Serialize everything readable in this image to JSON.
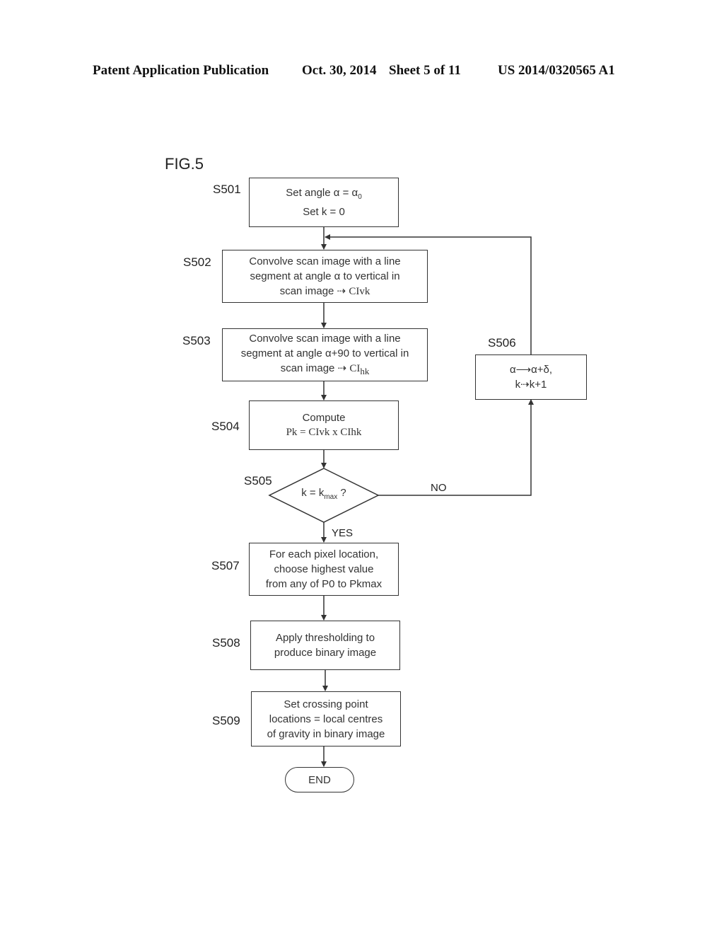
{
  "header": {
    "publication": "Patent Application Publication",
    "date": "Oct. 30, 2014",
    "sheet": "Sheet 5 of 11",
    "number": "US 2014/0320565 A1"
  },
  "figure": {
    "title": "FIG.5"
  },
  "steps": {
    "s501": {
      "label": "S501",
      "line1": "Set angle α = α",
      "line1_sub": "0",
      "line2": "Set k = 0"
    },
    "s502": {
      "label": "S502",
      "line1": "Convolve scan image with a line",
      "line2": "segment at angle α to vertical in",
      "line3": "scan image ⇢ ",
      "line3_var": "CIvk"
    },
    "s503": {
      "label": "S503",
      "line1": "Convolve scan image with a line",
      "line2": "segment at angle α+90 to vertical in",
      "line3": "scan image ⇢ ",
      "line3_var": "CI",
      "line3_sub": "hk"
    },
    "s504": {
      "label": "S504",
      "line1": "Compute",
      "line2": "Pk = CIvk x CIhk"
    },
    "s505": {
      "label": "S505",
      "text": "k = k",
      "text_sub": "max",
      "text_end": " ?",
      "no_label": "NO",
      "yes_label": "YES"
    },
    "s506": {
      "label": "S506",
      "line1": "α⟶α+δ,",
      "line2": "k⇢k+1"
    },
    "s507": {
      "label": "S507",
      "line1": "For each pixel location,",
      "line2": "choose highest value",
      "line3": "from any of  P0 to Pkmax"
    },
    "s508": {
      "label": "S508",
      "line1": "Apply thresholding to",
      "line2": "produce binary image"
    },
    "s509": {
      "label": "S509",
      "line1": "Set crossing point",
      "line2": "locations = local centres",
      "line3": "of gravity in binary image"
    },
    "end": {
      "label": "END"
    }
  }
}
